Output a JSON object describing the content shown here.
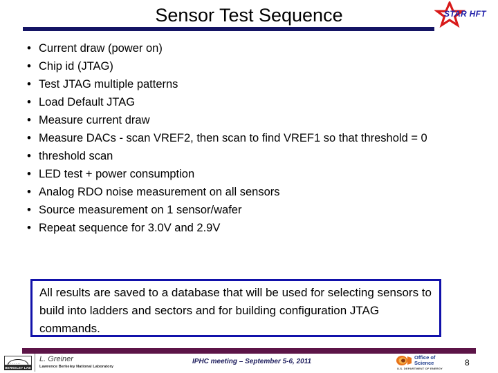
{
  "slide": {
    "title": "Sensor Test Sequence",
    "rule_color": "#141464"
  },
  "logo": {
    "name": "star-hft-logo",
    "text": "STAR HFT",
    "star_color": "#d81919",
    "text_color": "#2222aa"
  },
  "bullets": [
    {
      "marker": "•",
      "text": "Current draw (power on)"
    },
    {
      "marker": "•",
      "text": "Chip id (JTAG)"
    },
    {
      "marker": "•",
      "text": "Test JTAG multiple patterns"
    },
    {
      "marker": "•",
      "text": "Load Default JTAG"
    },
    {
      "marker": "•",
      "text": "Measure current draw"
    },
    {
      "marker": "•",
      "text": "Measure DACs - scan VREF2, then scan to find VREF1 so that threshold = 0"
    },
    {
      "marker": "•",
      "text": "threshold scan"
    },
    {
      "marker": "•",
      "text": "LED test + power consumption"
    },
    {
      "marker": "•",
      "text": "Analog RDO noise measurement on all sensors"
    },
    {
      "marker": "•",
      "text": "Source measurement on 1 sensor/wafer"
    },
    {
      "marker": "•",
      "text": "Repeat sequence for 3.0V and 2.9V"
    }
  ],
  "callout": {
    "text": "All results are saved to a database that will be used for selecting sensors to build into ladders and sectors and for building configuration JTAG commands.",
    "border_color": "#1111aa"
  },
  "footer": {
    "bar_color": "#5b1449",
    "presenter": "L. Greiner",
    "institution": "Lawrence Berkeley National Laboratory",
    "lab_logo_tag": "BERKELEY LAB",
    "lab_logo_dots": "·······",
    "meeting": "IPHC meeting – September 5-6, 2011",
    "doe_line1": "Office of",
    "doe_line2": "Science",
    "doe_sub": "U.S. DEPARTMENT OF ENERGY",
    "page_number": "8"
  }
}
